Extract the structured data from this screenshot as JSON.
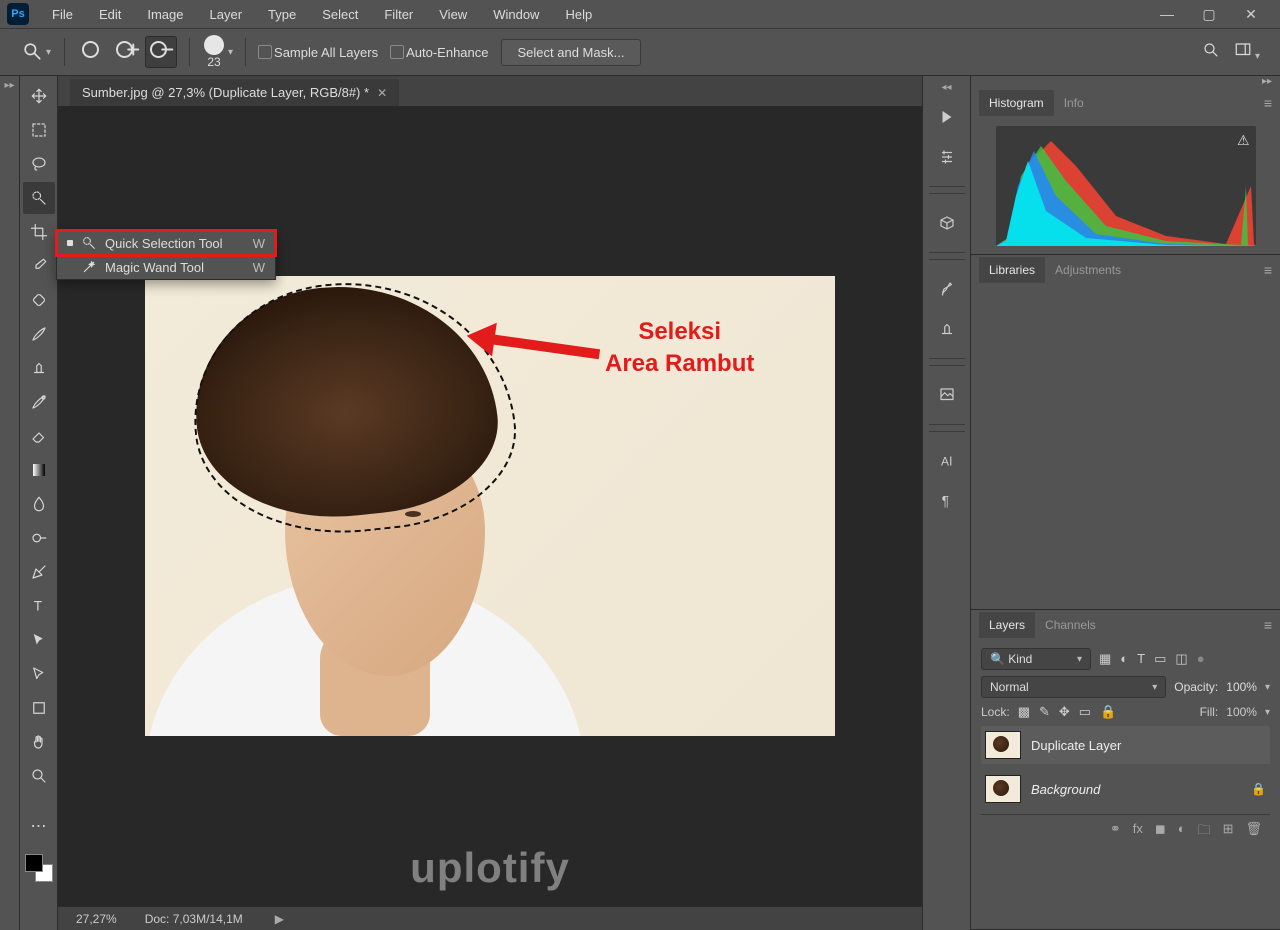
{
  "app": {
    "logo": "Ps"
  },
  "menu": {
    "items": [
      "File",
      "Edit",
      "Image",
      "Layer",
      "Type",
      "Select",
      "Filter",
      "View",
      "Window",
      "Help"
    ]
  },
  "options": {
    "brush_size": "23",
    "sample_all": "Sample All Layers",
    "auto_enhance": "Auto-Enhance",
    "select_mask": "Select and Mask..."
  },
  "document": {
    "tab_title": "Sumber.jpg @ 27,3% (Duplicate Layer, RGB/8#) *",
    "zoom": "27,27%",
    "doc_info": "Doc: 7,03M/14,1M"
  },
  "tool_flyout": {
    "items": [
      {
        "label": "Quick Selection Tool",
        "key": "W",
        "active": true
      },
      {
        "label": "Magic Wand Tool",
        "key": "W",
        "active": false
      }
    ]
  },
  "annotation": {
    "line1": "Seleksi",
    "line2": "Area Rambut"
  },
  "watermark": "uplotify",
  "panels": {
    "histogram": {
      "tabs": [
        "Histogram",
        "Info"
      ]
    },
    "libraries": {
      "tabs": [
        "Libraries",
        "Adjustments"
      ]
    },
    "layers": {
      "tabs": [
        "Layers",
        "Channels"
      ],
      "kind": "Kind",
      "blend": "Normal",
      "opacity_label": "Opacity:",
      "opacity_value": "100%",
      "lock_label": "Lock:",
      "fill_label": "Fill:",
      "fill_value": "100%",
      "items": [
        {
          "name": "Duplicate Layer",
          "locked": false,
          "italic": false
        },
        {
          "name": "Background",
          "locked": true,
          "italic": true
        }
      ]
    }
  }
}
